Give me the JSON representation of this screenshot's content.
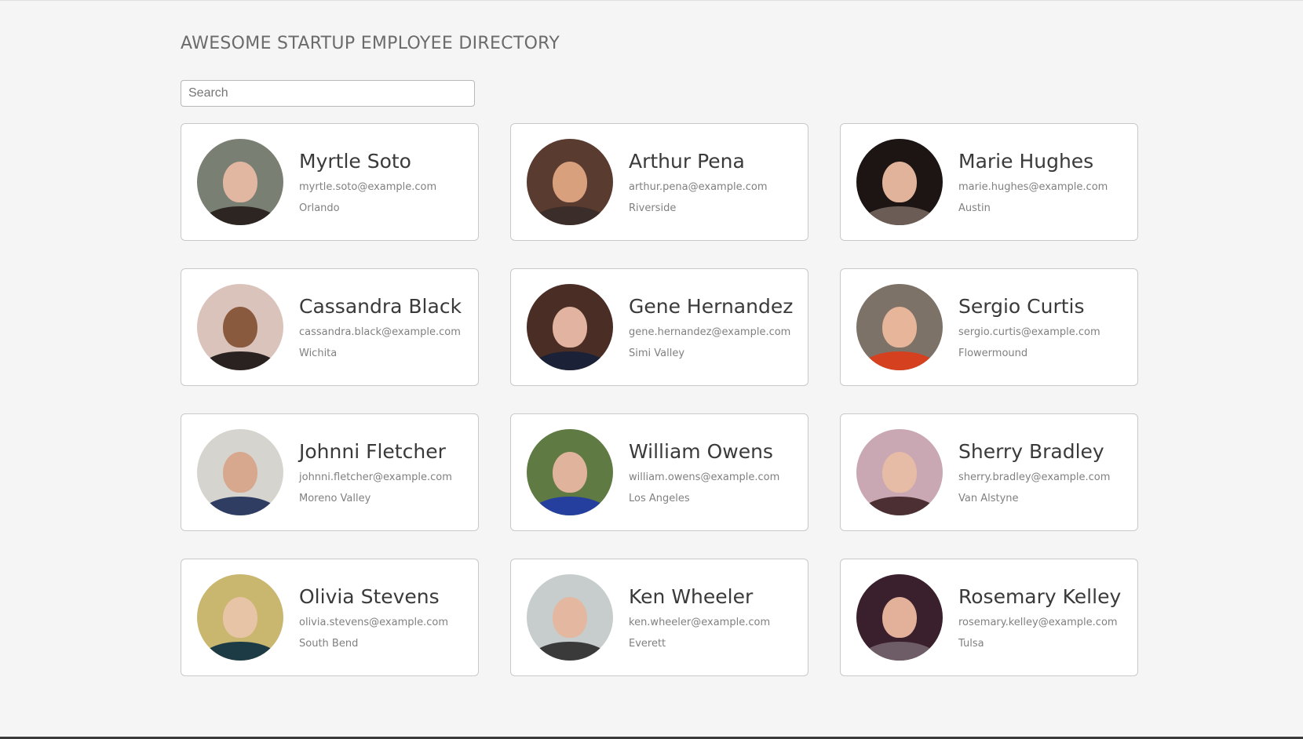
{
  "header": {
    "title": "AWESOME STARTUP EMPLOYEE DIRECTORY"
  },
  "search": {
    "placeholder": "Search",
    "value": ""
  },
  "employees": [
    {
      "name": "Myrtle Soto",
      "email": "myrtle.soto@example.com",
      "city": "Orlando",
      "avatar": {
        "bg": "#7a7f74",
        "skin": "#e2b7a2",
        "body": "#2c2522"
      }
    },
    {
      "name": "Arthur Pena",
      "email": "arthur.pena@example.com",
      "city": "Riverside",
      "avatar": {
        "bg": "#5a3b30",
        "skin": "#d9a07e",
        "body": "#3b2e2a"
      }
    },
    {
      "name": "Marie Hughes",
      "email": "marie.hughes@example.com",
      "city": "Austin",
      "avatar": {
        "bg": "#1d1514",
        "skin": "#e0b39a",
        "body": "#6b5c55"
      }
    },
    {
      "name": "Cassandra Black",
      "email": "cassandra.black@example.com",
      "city": "Wichita",
      "avatar": {
        "bg": "#d9c3bb",
        "skin": "#8a5a3f",
        "body": "#2a2220"
      }
    },
    {
      "name": "Gene Hernandez",
      "email": "gene.hernandez@example.com",
      "city": "Simi Valley",
      "avatar": {
        "bg": "#4a2d25",
        "skin": "#e2b3a0",
        "body": "#1b2136"
      }
    },
    {
      "name": "Sergio Curtis",
      "email": "sergio.curtis@example.com",
      "city": "Flowermound",
      "avatar": {
        "bg": "#7d7268",
        "skin": "#e6b59a",
        "body": "#d5411f"
      }
    },
    {
      "name": "Johnni Fletcher",
      "email": "johnni.fletcher@example.com",
      "city": "Moreno Valley",
      "avatar": {
        "bg": "#d6d4cf",
        "skin": "#d7a88e",
        "body": "#2f3d63"
      }
    },
    {
      "name": "William Owens",
      "email": "william.owens@example.com",
      "city": "Los Angeles",
      "avatar": {
        "bg": "#5f7a43",
        "skin": "#e0b49c",
        "body": "#253f9e"
      }
    },
    {
      "name": "Sherry Bradley",
      "email": "sherry.bradley@example.com",
      "city": "Van Alstyne",
      "avatar": {
        "bg": "#c9a8b4",
        "skin": "#e6bca6",
        "body": "#4b2f33"
      }
    },
    {
      "name": "Olivia Stevens",
      "email": "olivia.stevens@example.com",
      "city": "South Bend",
      "avatar": {
        "bg": "#c9b66f",
        "skin": "#e8c4a6",
        "body": "#1d3b45"
      }
    },
    {
      "name": "Ken Wheeler",
      "email": "ken.wheeler@example.com",
      "city": "Everett",
      "avatar": {
        "bg": "#c7cdcd",
        "skin": "#e3b7a0",
        "body": "#3a3a3a"
      }
    },
    {
      "name": "Rosemary Kelley",
      "email": "rosemary.kelley@example.com",
      "city": "Tulsa",
      "avatar": {
        "bg": "#3a1f2c",
        "skin": "#e3b09a",
        "body": "#6e5d66"
      }
    }
  ]
}
